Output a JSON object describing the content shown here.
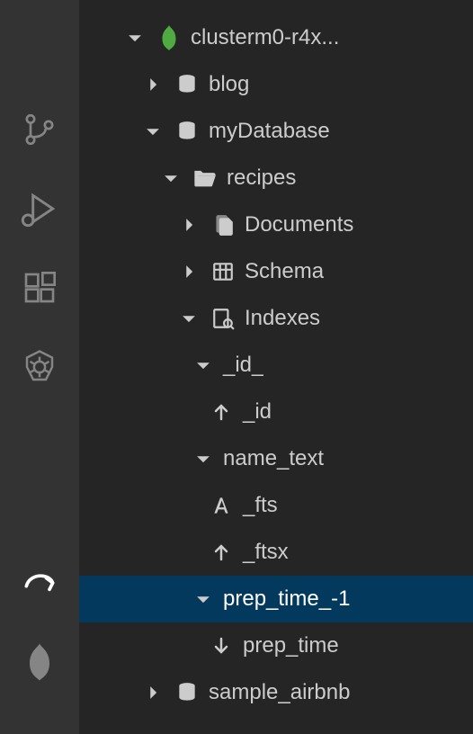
{
  "actbar": {
    "items": [
      {
        "name": "source-control"
      },
      {
        "name": "debug"
      },
      {
        "name": "extensions"
      },
      {
        "name": "kubernetes"
      },
      {
        "name": "share",
        "active": true
      },
      {
        "name": "mongodb"
      }
    ]
  },
  "tree": {
    "cluster": "clusterm0-r4x...",
    "databases": [
      {
        "name": "blog",
        "expanded": false
      },
      {
        "name": "myDatabase",
        "expanded": true,
        "collections": [
          {
            "name": "recipes",
            "expanded": true,
            "sections": [
              {
                "name": "Documents",
                "icon": "documents",
                "expanded": false,
                "hasChevron": true
              },
              {
                "name": "Schema",
                "icon": "schema",
                "expanded": false,
                "hasChevron": true
              },
              {
                "name": "Indexes",
                "icon": "indexes",
                "expanded": true,
                "hasChevron": true,
                "indexes": [
                  {
                    "name": "_id_",
                    "expanded": true,
                    "fields": [
                      {
                        "name": "_id",
                        "dir": "asc"
                      }
                    ]
                  },
                  {
                    "name": "name_text",
                    "expanded": true,
                    "fields": [
                      {
                        "name": "_fts",
                        "dir": "text"
                      },
                      {
                        "name": "_ftsx",
                        "dir": "asc"
                      }
                    ]
                  },
                  {
                    "name": "prep_time_-1",
                    "expanded": true,
                    "selected": true,
                    "fields": [
                      {
                        "name": "prep_time",
                        "dir": "desc"
                      }
                    ]
                  }
                ]
              }
            ]
          }
        ]
      },
      {
        "name": "sample_airbnb",
        "expanded": false
      }
    ]
  }
}
